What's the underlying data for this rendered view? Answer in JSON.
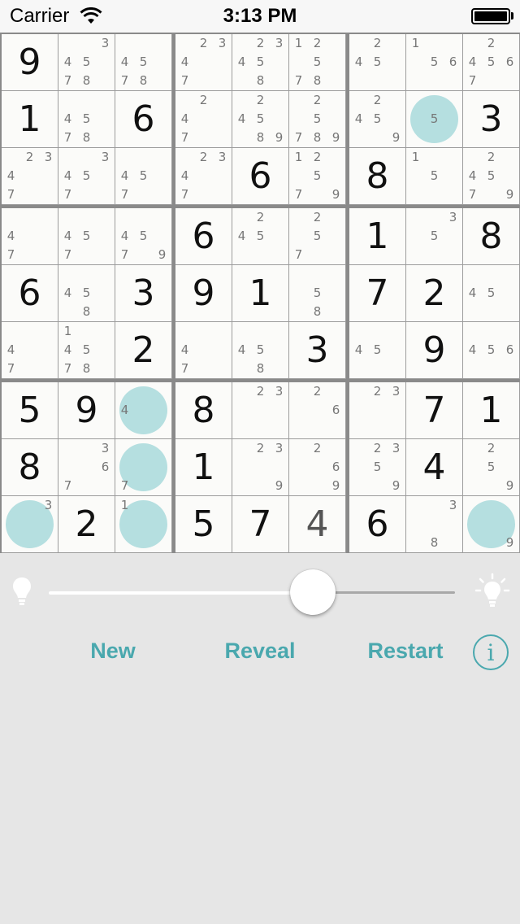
{
  "status_bar": {
    "carrier": "Carrier",
    "time": "3:13 PM"
  },
  "board": {
    "rows": [
      [
        {
          "v": "9"
        },
        {
          "c": [
            "3",
            "4",
            "5",
            "7",
            "8"
          ]
        },
        {
          "c": [
            "4",
            "5",
            "7",
            "8"
          ]
        },
        {
          "c": [
            "2",
            "3",
            "4",
            "7"
          ]
        },
        {
          "c": [
            "2",
            "3",
            "4",
            "5",
            "8"
          ]
        },
        {
          "c": [
            "1",
            "2",
            "5",
            "7",
            "8"
          ]
        },
        {
          "c": [
            "2",
            "4",
            "5"
          ]
        },
        {
          "c": [
            "1",
            "5",
            "6"
          ]
        },
        {
          "c": [
            "2",
            "4",
            "5",
            "6",
            "7"
          ]
        }
      ],
      [
        {
          "v": "1"
        },
        {
          "c": [
            "4",
            "5",
            "7",
            "8"
          ]
        },
        {
          "v": "6"
        },
        {
          "c": [
            "2",
            "4",
            "7"
          ]
        },
        {
          "c": [
            "2",
            "4",
            "5",
            "8",
            "9"
          ]
        },
        {
          "c": [
            "2",
            "5",
            "7",
            "8",
            "9"
          ]
        },
        {
          "c": [
            "2",
            "4",
            "5",
            "9"
          ]
        },
        {
          "c": [
            "5"
          ],
          "h": true
        },
        {
          "v": "3"
        }
      ],
      [
        {
          "c": [
            "2",
            "3",
            "4",
            "7"
          ]
        },
        {
          "c": [
            "3",
            "4",
            "5",
            "7"
          ]
        },
        {
          "c": [
            "4",
            "5",
            "7"
          ]
        },
        {
          "c": [
            "2",
            "3",
            "4",
            "7"
          ]
        },
        {
          "v": "6"
        },
        {
          "c": [
            "1",
            "2",
            "5",
            "7",
            "9"
          ]
        },
        {
          "v": "8"
        },
        {
          "c": [
            "1",
            "5"
          ]
        },
        {
          "c": [
            "2",
            "4",
            "5",
            "7",
            "9"
          ]
        }
      ],
      [
        {
          "c": [
            "4",
            "7"
          ]
        },
        {
          "c": [
            "4",
            "5",
            "7"
          ]
        },
        {
          "c": [
            "4",
            "5",
            "7",
            "9"
          ]
        },
        {
          "v": "6"
        },
        {
          "c": [
            "2",
            "4",
            "5"
          ]
        },
        {
          "c": [
            "2",
            "5",
            "7"
          ]
        },
        {
          "v": "1"
        },
        {
          "c": [
            "3",
            "5"
          ]
        },
        {
          "v": "8"
        }
      ],
      [
        {
          "v": "6"
        },
        {
          "c": [
            "4",
            "5",
            "8"
          ]
        },
        {
          "v": "3"
        },
        {
          "v": "9"
        },
        {
          "v": "1"
        },
        {
          "c": [
            "5",
            "8"
          ]
        },
        {
          "v": "7"
        },
        {
          "v": "2"
        },
        {
          "c": [
            "4",
            "5"
          ]
        }
      ],
      [
        {
          "c": [
            "4",
            "7"
          ]
        },
        {
          "c": [
            "1",
            "4",
            "5",
            "7",
            "8"
          ]
        },
        {
          "v": "2"
        },
        {
          "c": [
            "4",
            "7"
          ]
        },
        {
          "c": [
            "4",
            "5",
            "8"
          ]
        },
        {
          "v": "3"
        },
        {
          "c": [
            "4",
            "5"
          ]
        },
        {
          "v": "9"
        },
        {
          "c": [
            "4",
            "5",
            "6"
          ]
        }
      ],
      [
        {
          "v": "5"
        },
        {
          "v": "9"
        },
        {
          "c": [
            "4"
          ],
          "h": true
        },
        {
          "v": "8"
        },
        {
          "c": [
            "2",
            "3"
          ]
        },
        {
          "c": [
            "2",
            "6"
          ]
        },
        {
          "c": [
            "2",
            "3"
          ]
        },
        {
          "v": "7"
        },
        {
          "v": "1"
        }
      ],
      [
        {
          "v": "8"
        },
        {
          "c": [
            "3",
            "6",
            "7"
          ]
        },
        {
          "c": [
            "7"
          ],
          "h": true
        },
        {
          "v": "1"
        },
        {
          "c": [
            "2",
            "3",
            "9"
          ]
        },
        {
          "c": [
            "2",
            "6",
            "9"
          ]
        },
        {
          "c": [
            "2",
            "3",
            "5",
            "9"
          ]
        },
        {
          "v": "4"
        },
        {
          "c": [
            "2",
            "5",
            "9"
          ]
        }
      ],
      [
        {
          "c": [
            "3"
          ],
          "h": true
        },
        {
          "v": "2"
        },
        {
          "c": [
            "1"
          ],
          "h": true
        },
        {
          "v": "5"
        },
        {
          "v": "7"
        },
        {
          "v": "4",
          "u": true
        },
        {
          "v": "6"
        },
        {
          "c": [
            "3",
            "8"
          ]
        },
        {
          "c": [
            "9"
          ],
          "h": true
        }
      ]
    ]
  },
  "controls": {
    "brightness_level": 0.65,
    "new_label": "New",
    "reveal_label": "Reveal",
    "restart_label": "Restart",
    "info_label": "i"
  },
  "colors": {
    "accent": "#4aa8ae",
    "highlight": "#b5dfe0",
    "background": "#e6e6e6"
  }
}
